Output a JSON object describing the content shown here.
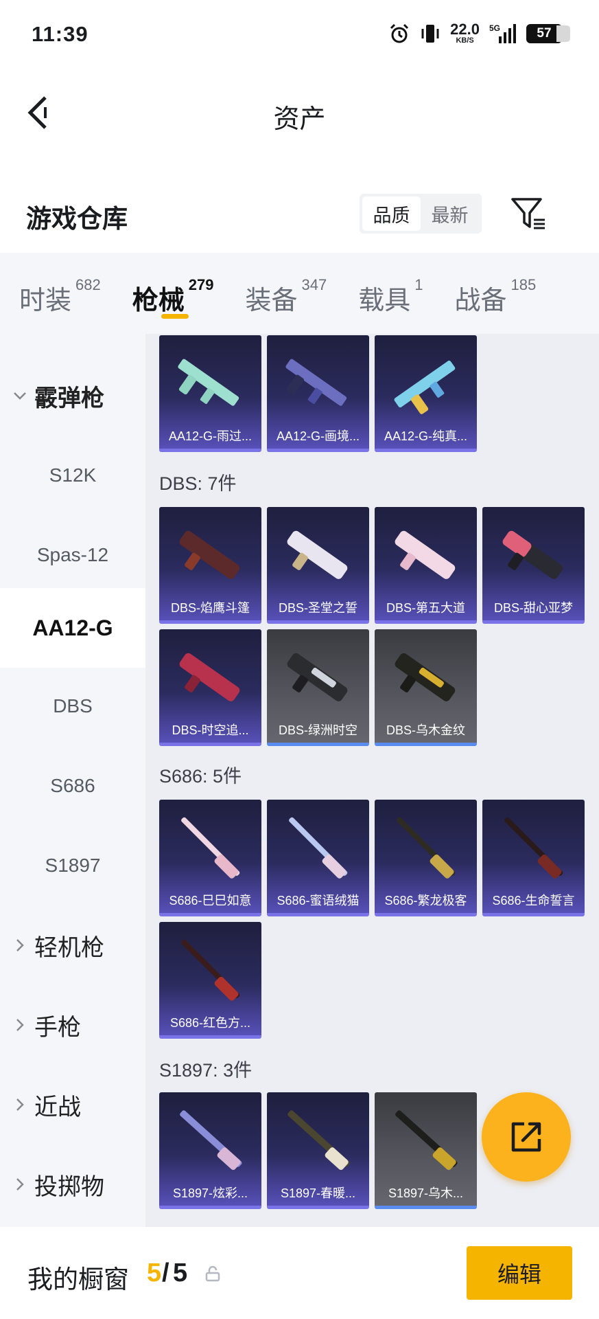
{
  "status_bar": {
    "time": "11:39",
    "net_speed": "22.0",
    "net_unit": "KB/S",
    "network": "5G",
    "battery": "57"
  },
  "header": {
    "title": "资产"
  },
  "warehouse": {
    "title": "游戏仓库",
    "sort_options": [
      "品质",
      "最新"
    ],
    "active_sort": "品质"
  },
  "category_tabs": [
    {
      "name": "时装",
      "count": "682"
    },
    {
      "name": "枪械",
      "count": "279",
      "active": true
    },
    {
      "name": "装备",
      "count": "347"
    },
    {
      "name": "载具",
      "count": "1"
    },
    {
      "name": "战备",
      "count": "185"
    }
  ],
  "sidebar": {
    "group_open": "霰弹枪",
    "sub_items": [
      "S12K",
      "Spas-12",
      "AA12-G",
      "DBS",
      "S686",
      "S1897"
    ],
    "active_sub": "AA12-G",
    "groups_closed": [
      "轻机枪",
      "手枪",
      "近战",
      "投掷物"
    ]
  },
  "sections": [
    {
      "label": "",
      "items": [
        "AA12-G-雨过...",
        "AA12-G-画境...",
        "AA12-G-纯真..."
      ]
    },
    {
      "label": "DBS: 7件",
      "items": [
        "DBS-焰鹰斗篷",
        "DBS-圣堂之誓",
        "DBS-第五大道",
        "DBS-甜心亚梦",
        "DBS-时空追...",
        "DBS-绿洲时空",
        "DBS-乌木金纹"
      ]
    },
    {
      "label": "S686: 5件",
      "items": [
        "S686-巳巳如意",
        "S686-蜜语绒猫",
        "S686-繁龙极客",
        "S686-生命誓言",
        "S686-红色方..."
      ]
    },
    {
      "label": "S1897: 3件",
      "items": [
        "S1897-炫彩...",
        "S1897-春暖...",
        "S1897-乌木..."
      ]
    }
  ],
  "bottom_bar": {
    "showcase_label": "我的橱窗",
    "used": "5",
    "slash": "/",
    "total": "5",
    "edit_label": "编辑"
  },
  "colors": {
    "accent": "#f5b400",
    "card_purple": "#5750b8",
    "card_grey": "#56575e"
  },
  "icons": [
    "alarm-icon",
    "vibrate-icon",
    "signal-icon",
    "back-arrow-icon",
    "filter-icon",
    "chevron-down-icon",
    "chevron-right-icon",
    "share-out-icon",
    "lock-icon",
    "gun-icon"
  ]
}
